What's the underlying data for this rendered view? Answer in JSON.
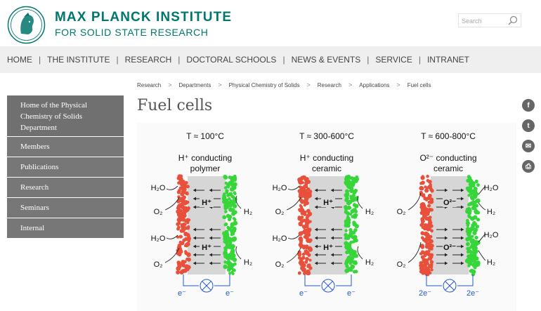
{
  "header": {
    "title_line1": "MAX PLANCK INSTITUTE",
    "title_line2": "FOR SOLID STATE RESEARCH",
    "search_placeholder": "Search"
  },
  "nav": {
    "items": [
      "HOME",
      "THE INSTITUTE",
      "RESEARCH",
      "DOCTORAL SCHOOLS",
      "NEWS & EVENTS",
      "SERVICE",
      "INTRANET"
    ],
    "separator": "|"
  },
  "breadcrumb": {
    "items": [
      "Research",
      "Departments",
      "Physical Chemistry of Solids",
      "Research",
      "Applications",
      "Fuel cells"
    ],
    "separator": ">"
  },
  "page_title": "Fuel cells",
  "sidebar": {
    "items": [
      "Home of the Physical Chemistry of Solids Department",
      "Members",
      "Publications",
      "Research",
      "Seminars",
      "Internal"
    ]
  },
  "social": {
    "icons": [
      "facebook-icon",
      "twitter-icon",
      "email-icon",
      "print-icon"
    ],
    "glyphs": [
      "f",
      "t",
      "✉",
      "⎙"
    ]
  },
  "figure": {
    "panels": [
      {
        "temperature": "T ≈ 100°C",
        "type_line1": "H⁺ conducting",
        "type_line2": "polymer",
        "ion": "H⁺",
        "left_top": "H₂O",
        "left_mid1": "O₂",
        "left_mid2": "H₂O",
        "left_bottom": "O₂",
        "right_top": "",
        "right_mid1": "H₂",
        "right_mid2": "",
        "right_bottom": "H₂",
        "electron_left": "e⁻",
        "electron_right": "e⁻"
      },
      {
        "temperature": "T ≈ 300-600°C",
        "type_line1": "H⁺ conducting",
        "type_line2": "ceramic",
        "ion": "H⁺",
        "left_top": "H₂O",
        "left_mid1": "O₂",
        "left_mid2": "H₂O",
        "left_bottom": "O₂",
        "right_top": "",
        "right_mid1": "H₂",
        "right_mid2": "",
        "right_bottom": "H₂",
        "electron_left": "e⁻",
        "electron_right": "e⁻"
      },
      {
        "temperature": "T ≈ 600-800°C",
        "type_line1": "O²⁻ conducting",
        "type_line2": "ceramic",
        "ion": "O²⁻",
        "left_top": "",
        "left_mid1": "O₂",
        "left_mid2": "",
        "left_bottom": "O₂",
        "right_top": "H₂O",
        "right_mid1": "H₂",
        "right_mid2": "H₂O",
        "right_bottom": "H₂",
        "electron_left": "2e⁻",
        "electron_right": "2e⁻"
      }
    ],
    "colors": {
      "cathode": "#e8503c",
      "anode": "#36d63a",
      "electrolyte": "#d6d6d6",
      "wire": "#2255cc",
      "brand": "#00766c"
    }
  }
}
